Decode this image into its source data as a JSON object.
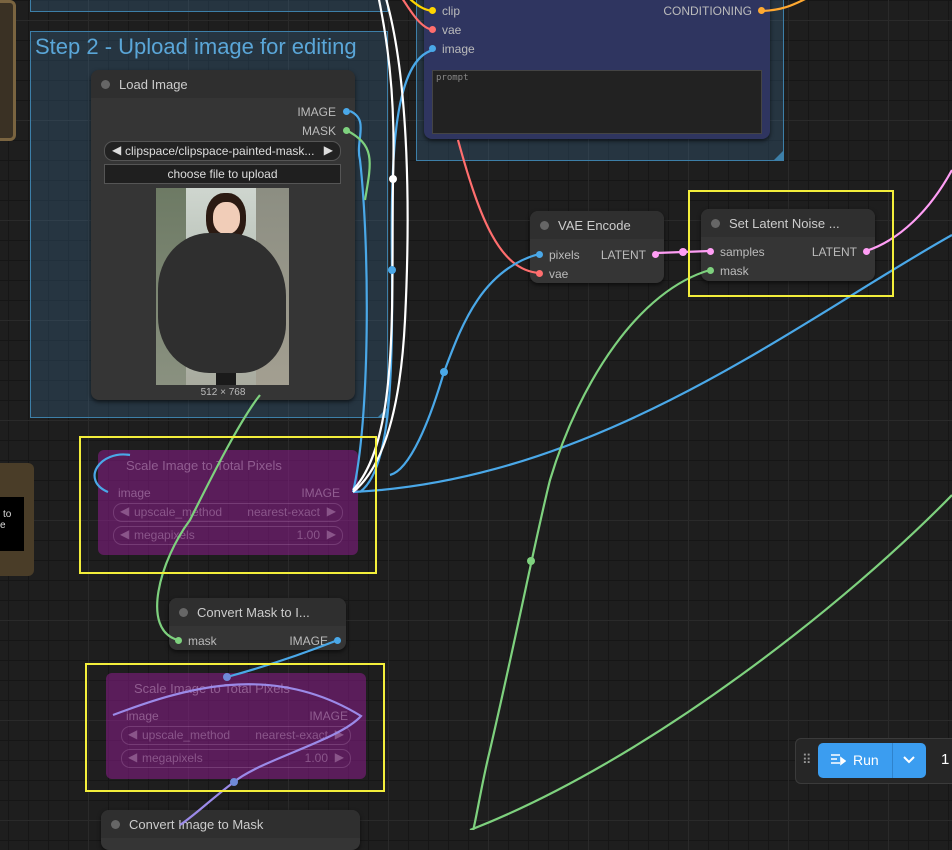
{
  "step2_group": {
    "title": "Step 2 - Upload image for editing"
  },
  "prompt_node": {
    "inputs": [
      "clip",
      "vae",
      "image"
    ],
    "output": "CONDITIONING",
    "prompt_placeholder": "prompt"
  },
  "load_image": {
    "title": "Load Image",
    "outputs": [
      "IMAGE",
      "MASK"
    ],
    "file_value": "clipspace/clipspace-painted-mask...",
    "upload_label": "choose file to upload",
    "dimensions": "512 × 768"
  },
  "vae_encode": {
    "title": "VAE Encode",
    "inputs": [
      "pixels",
      "vae"
    ],
    "output": "LATENT"
  },
  "set_latent_noise": {
    "title": "Set Latent Noise ...",
    "inputs": [
      "samples",
      "mask"
    ],
    "output": "LATENT"
  },
  "scale_image_1": {
    "title": "Scale Image to Total Pixels",
    "input": "image",
    "output": "IMAGE",
    "upscale_label": "upscale_method",
    "upscale_value": "nearest-exact",
    "mega_label": "megapixels",
    "mega_value": "1.00"
  },
  "convert_mask": {
    "title": "Convert Mask to I...",
    "input": "mask",
    "output": "IMAGE"
  },
  "scale_image_2": {
    "title": "Scale Image to Total Pixels",
    "input": "image",
    "output": "IMAGE",
    "upscale_label": "upscale_method",
    "upscale_value": "nearest-exact",
    "mega_label": "megapixels",
    "mega_value": "1.00"
  },
  "convert_image_to_mask": {
    "title": "Convert Image to Mask"
  },
  "left_card": {
    "lines": [
      "to",
      "e"
    ]
  },
  "run_bar": {
    "run_label": "Run",
    "batch_count": "1"
  },
  "colors": {
    "image_link": "#4aa8e8",
    "mask_link": "#7ed17e",
    "latent_link": "#ff9ef5",
    "vae_link": "#ff6e6e",
    "clip_pin": "#ffd500",
    "conditioning": "#ffa931",
    "highlight": "#f3ee3b",
    "run_button": "#3b9df0"
  }
}
